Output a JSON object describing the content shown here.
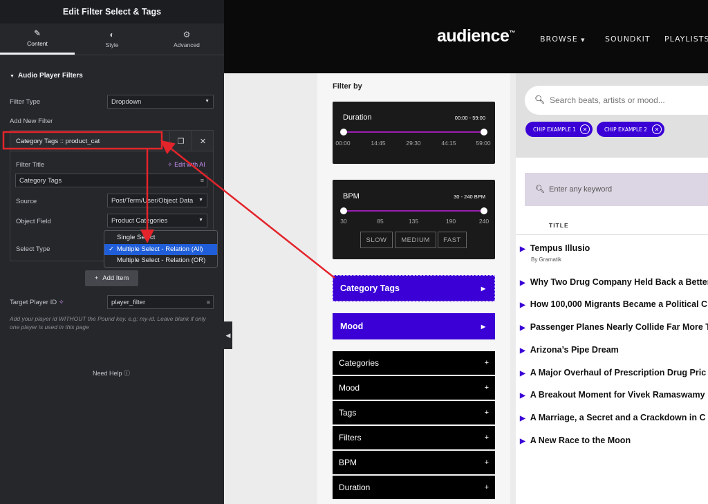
{
  "editor": {
    "title": "Edit Filter Select & Tags",
    "tabs": [
      {
        "label": "Content",
        "icon": "pencil-icon"
      },
      {
        "label": "Style",
        "icon": "contrast-icon"
      },
      {
        "label": "Advanced",
        "icon": "gear-icon"
      }
    ],
    "section_title": "Audio Player Filters",
    "filter_type_label": "Filter Type",
    "filter_type_value": "Dropdown",
    "add_new_filter_label": "Add New Filter",
    "repeater_item_title": "Category Tags :: product_cat",
    "filter_title_label": "Filter Title",
    "edit_with_ai": "Edit with AI",
    "filter_title_value": "Category Tags",
    "source_label": "Source",
    "source_value": "Post/Term/User/Object Data",
    "object_field_label": "Object Field",
    "object_field_value": "Product Categories",
    "select_type_label": "Select Type",
    "select_type_options": [
      "Single Select",
      "Multiple Select - Relation (All)",
      "Multiple Select - Relation (OR)"
    ],
    "select_type_selected": "Multiple Select - Relation (All)",
    "add_item_label": "Add Item",
    "target_player_label": "Target Player ID",
    "target_player_value": "player_filter",
    "help_text": "Add your player id WITHOUT the Pound key. e.g: my-id. Leave blank if only one player is used in this page",
    "need_help": "Need Help"
  },
  "site": {
    "logo": "audience",
    "logo_tm": "™",
    "nav": [
      "BROWSE",
      "SOUNDKIT",
      "PLAYLISTS"
    ],
    "filter_by": "Filter by",
    "duration": {
      "title": "Duration",
      "range": "00:00 - 59:00",
      "ticks": [
        "00:00",
        "14:45",
        "29:30",
        "44:15",
        "59:00"
      ],
      "min": "00:00",
      "max": "59:00"
    },
    "bpm": {
      "title": "BPM",
      "range": "30 - 240 BPM",
      "ticks": [
        "30",
        "85",
        "135",
        "190",
        "240"
      ],
      "min": 30,
      "max": 240,
      "buttons": [
        "SLOW",
        "MEDIUM",
        "FAST"
      ]
    },
    "purple_filters": [
      "Category Tags",
      "Mood"
    ],
    "accordion": [
      "Categories",
      "Mood",
      "Tags",
      "Filters",
      "BPM",
      "Duration"
    ],
    "search_placeholder": "Search beats, artists or mood...",
    "chips": [
      "CHIP EXAMPLE 1",
      "CHIP EXAMPLE 2"
    ],
    "keyword_placeholder": "Enter any keyword",
    "column_title": "TITLE",
    "tracks": [
      {
        "title": "Tempus Illusio",
        "artist": "By Gramatik"
      },
      {
        "title": "Why Two Drug Company Held Back a Better"
      },
      {
        "title": "How 100,000 Migrants Became a Political C"
      },
      {
        "title": "Passenger Planes Nearly Collide Far More T"
      },
      {
        "title": "Arizona’s Pipe Dream"
      },
      {
        "title": "A Major Overhaul of Prescription Drug Pric"
      },
      {
        "title": "A Breakout Moment for Vivek Ramaswamy"
      },
      {
        "title": "A Marriage, a Secret and a Crackdown in C"
      },
      {
        "title": "A New Race to the Moon"
      }
    ]
  },
  "colors": {
    "accent": "#3a00d6",
    "annotation": "#e3242b",
    "panel": "#26272b"
  }
}
